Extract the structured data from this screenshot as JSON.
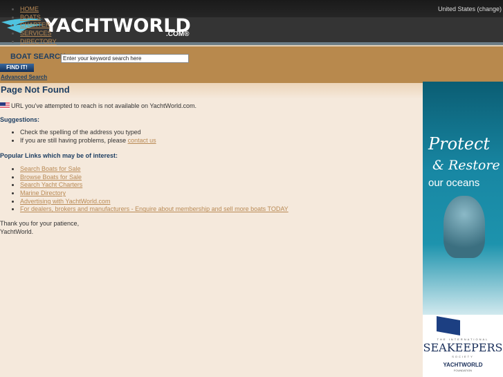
{
  "header": {
    "country": "United States (change)",
    "logo_word": "YACHTWORLD",
    "logo_com": ".COM®",
    "nav": [
      "HOME",
      "BOATS",
      "CHARTER",
      "SERVICES",
      "DIRECTORY"
    ]
  },
  "search": {
    "label": "BOAT SEARCH",
    "placeholder": "Enter your keyword search here",
    "find": "FIND IT!",
    "advanced": "Advanced Search"
  },
  "main": {
    "title": "Page Not Found",
    "message": "URL you've attempted to reach is not available on YachtWorld.com.",
    "suggestions_title": "Suggestions:",
    "suggestion1": "Check the spelling of the address you typed",
    "suggestion2_prefix": "If you are still having problems, please ",
    "contact": "contact us",
    "popular_title": "Popular Links which may be of interest:",
    "links": [
      "Search Boats for Sale",
      "Browse Boats for Sale",
      "Search Yacht Charters",
      "Marine Directory",
      "Advertising with YachtWorld.com",
      "For dealers, brokers and manufacturers - Enquire about membership and sell more boats TODAY"
    ],
    "thanks1": "Thank you for your patience,",
    "thanks2": "YachtWorld."
  },
  "ad": {
    "protect": "Protect",
    "restore": "& Restore",
    "oceans": "our oceans",
    "intl": "THE INTERNATIONAL",
    "seakeepers": "SEAKEEPERS",
    "society": "SOCIETY",
    "yw": "YACHTWORLD",
    "foundation": "FOUNDATION"
  }
}
